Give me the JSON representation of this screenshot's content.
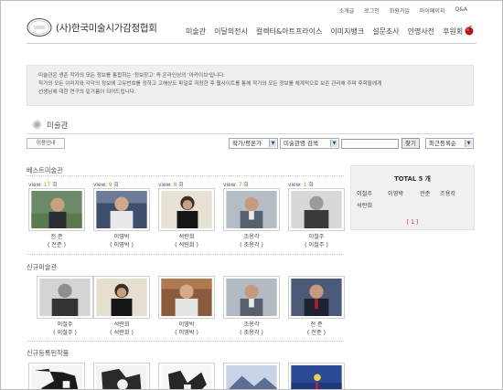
{
  "top_links": [
    "소개글",
    "로그인",
    "회원가입",
    "마이페이지",
    "Q&A"
  ],
  "logo": {
    "text": "(사)한국미술시가감정협회",
    "emblem_text": "KOREA ART APPRAISAL"
  },
  "main_nav": [
    "미술관",
    "이달의전시",
    "컬렉터&아트프라이스",
    "이미지뱅크",
    "설문조사",
    "인명사전",
    "후원회"
  ],
  "intro": [
    "미술관은 생존 작가의 모든 정보를 통합하는 '정보창고' 즉 온라인상의 '아카이브'입니다.",
    "작가의 모든 이미지와 각각의 정보에 고유번호를 정하고 고해상도 파일로 저장한 후 웹사이트를 통해 작가의 모든 정보를 체계적으로 보존 관리해 주며 후학들에게",
    "선생님에 대한 연구의 밑거름이 되어드립니다."
  ],
  "section_title": "미술관",
  "controls": {
    "guide_button": "이용안내",
    "category_select": "작가/평론가",
    "search_select": "미술관명 검색",
    "search_value": "",
    "search_button": "찾기",
    "sort_select": "최근등록순"
  },
  "best": {
    "title": "베스트미술관",
    "view_label": "view:",
    "unit": "회",
    "items": [
      {
        "views": "17",
        "name": "전 준",
        "sub": "( 전준 )"
      },
      {
        "views": "9",
        "name": "이영박",
        "sub": "( 이영박 )"
      },
      {
        "views": "8",
        "name": "석란희",
        "sub": "( 석란희 )"
      },
      {
        "views": "7",
        "name": "조용각",
        "sub": "( 조용각 )"
      },
      {
        "views": "1",
        "name": "이철주",
        "sub": "( 이철주 )"
      }
    ]
  },
  "new_galleries": {
    "title": "신규미술관",
    "items": [
      {
        "name": "이철주",
        "sub": "( 이철주 )"
      },
      {
        "name": "석란희",
        "sub": "( 석란희 )"
      },
      {
        "name": "이영박",
        "sub": "( 이영박 )"
      },
      {
        "name": "조용각",
        "sub": "( 조용각 )"
      },
      {
        "name": "전 준",
        "sub": "( 전준 )"
      }
    ]
  },
  "new_works": {
    "title": "신규등록된작품"
  },
  "total": {
    "label": "TOTAL",
    "count": "5",
    "unit": "개",
    "names": [
      "이철주",
      "이영박",
      "전준",
      "조용각",
      "석란희"
    ],
    "page": "[ 1 ]"
  },
  "colors": {
    "accent_orange": "#e07b00",
    "page_red": "#c1272d",
    "intro_bg": "#efefef"
  }
}
